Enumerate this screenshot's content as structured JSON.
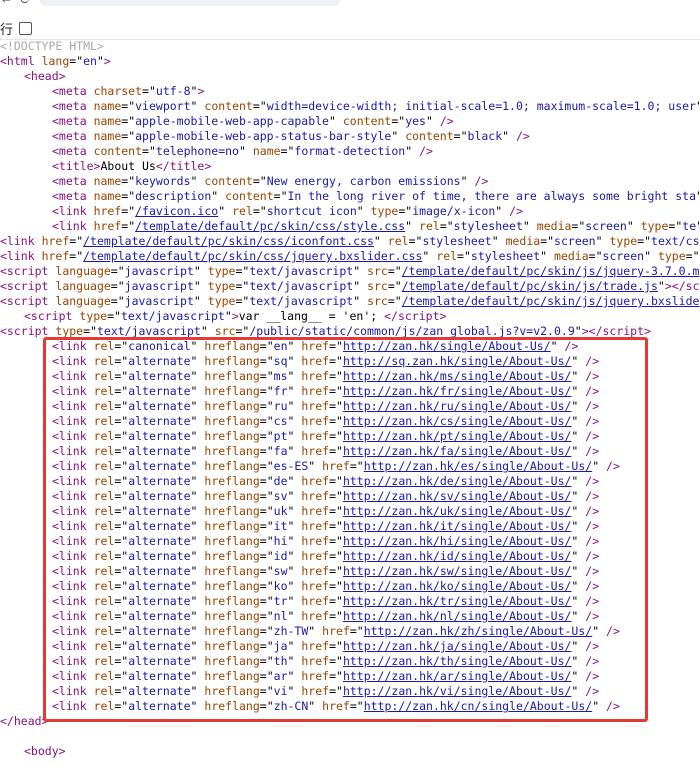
{
  "toolbar": {
    "wrap_label": "行"
  },
  "code_lines": [
    {
      "indent": 0,
      "raw": "<!DOCTYPE HTML>"
    },
    {
      "indent": 0,
      "tag": "html",
      "attrs": [
        [
          "lang",
          "en"
        ]
      ]
    },
    {
      "indent": 24,
      "tag": "head",
      "attrs": []
    },
    {
      "indent": 52,
      "tag": "meta",
      "attrs": [
        [
          "charset",
          "utf-8"
        ]
      ]
    },
    {
      "indent": 52,
      "tag": "meta",
      "attrs": [
        [
          "name",
          "viewport"
        ],
        [
          "content",
          "width=device-width; initial-scale=1.0; maximum-scale=1.0; user"
        ]
      ],
      "noclose": true
    },
    {
      "indent": 52,
      "tag": "meta",
      "attrs": [
        [
          "name",
          "apple-mobile-web-app-capable"
        ],
        [
          "content",
          "yes"
        ]
      ],
      "selfclose": true
    },
    {
      "indent": 52,
      "tag": "meta",
      "attrs": [
        [
          "name",
          "apple-mobile-web-app-status-bar-style"
        ],
        [
          "content",
          "black"
        ]
      ],
      "selfclose": true
    },
    {
      "indent": 52,
      "tag": "meta",
      "attrs": [
        [
          "content",
          "telephone=no"
        ],
        [
          "name",
          "format-detection"
        ]
      ],
      "selfclose": true
    },
    {
      "indent": 52,
      "tag": "title",
      "text": "About Us",
      "closetag": "title"
    },
    {
      "indent": 52,
      "tag": "meta",
      "attrs": [
        [
          "name",
          "keywords"
        ],
        [
          "content",
          "New energy, carbon emissions"
        ]
      ],
      "selfclose": true
    },
    {
      "indent": 52,
      "tag": "meta",
      "attrs": [
        [
          "name",
          "description"
        ],
        [
          "content",
          "In the long river of time, there are always some bright sta"
        ]
      ],
      "noclose": true
    },
    {
      "indent": 52,
      "tag": "link",
      "attrs": [
        [
          "href",
          "/favicon.ico",
          "link"
        ],
        [
          "rel",
          "shortcut icon"
        ],
        [
          "type",
          "image/x-icon"
        ]
      ],
      "selfclose": true
    },
    {
      "indent": 52,
      "tag": "link",
      "attrs": [
        [
          "href",
          "/template/default/pc/skin/css/style.css",
          "link"
        ],
        [
          "rel",
          "stylesheet"
        ],
        [
          "media",
          "screen"
        ],
        [
          "type",
          "te"
        ]
      ],
      "noclose": true
    },
    {
      "indent": 0,
      "tag": "link",
      "attrs": [
        [
          "href",
          "/template/default/pc/skin/css/iconfont.css",
          "link"
        ],
        [
          "rel",
          "stylesheet"
        ],
        [
          "media",
          "screen"
        ],
        [
          "type",
          "text/cs"
        ]
      ],
      "noclose": true
    },
    {
      "indent": 0,
      "tag": "link",
      "attrs": [
        [
          "href",
          "/template/default/pc/skin/css/jquery.bxslider.css",
          "link"
        ],
        [
          "rel",
          "stylesheet"
        ],
        [
          "media",
          "screen"
        ],
        [
          "type",
          ""
        ]
      ],
      "noclose": true
    },
    {
      "indent": 0,
      "tag": "script",
      "attrs": [
        [
          "language",
          "javascript"
        ],
        [
          "type",
          "text/javascript"
        ],
        [
          "src",
          "/template/default/pc/skin/js/jquery-3.7.0.m",
          "link"
        ]
      ],
      "noclose": true
    },
    {
      "indent": 0,
      "tag": "script",
      "attrs": [
        [
          "language",
          "javascript"
        ],
        [
          "type",
          "text/javascript"
        ],
        [
          "src",
          "/template/default/pc/skin/js/trade.js",
          "link"
        ]
      ],
      "text": "",
      "closetag": "scr"
    },
    {
      "indent": 0,
      "tag": "script",
      "attrs": [
        [
          "language",
          "javascript"
        ],
        [
          "type",
          "text/javascript"
        ],
        [
          "src",
          "/template/default/pc/skin/js/jquery.bxslide",
          "link"
        ]
      ],
      "noclose": true
    },
    {
      "indent": 24,
      "tag": "script",
      "attrs": [
        [
          "type",
          "text/javascript"
        ]
      ],
      "text": "var __lang__ = 'en'; ",
      "closetag": "script"
    },
    {
      "indent": 0,
      "tag": "script",
      "attrs": [
        [
          "type",
          "text/javascript"
        ],
        [
          "src",
          "/public/static/common/js/zan_global.js?v=v2.0.9"
        ]
      ],
      "text": "",
      "closetag": "script"
    },
    {
      "indent": 52,
      "tag": "link",
      "attrs": [
        [
          "rel",
          "canonical"
        ],
        [
          "hreflang",
          "en"
        ],
        [
          "href",
          "http://zan.hk/single/About-Us/",
          "link"
        ]
      ],
      "selfclose": true
    },
    {
      "indent": 52,
      "tag": "link",
      "attrs": [
        [
          "rel",
          "alternate"
        ],
        [
          "hreflang",
          "sq"
        ],
        [
          "href",
          "http://sq.zan.hk/single/About-Us/",
          "link"
        ]
      ],
      "selfclose": true
    },
    {
      "indent": 52,
      "tag": "link",
      "attrs": [
        [
          "rel",
          "alternate"
        ],
        [
          "hreflang",
          "ms"
        ],
        [
          "href",
          "http://zan.hk/ms/single/About-Us/",
          "link"
        ]
      ],
      "selfclose": true
    },
    {
      "indent": 52,
      "tag": "link",
      "attrs": [
        [
          "rel",
          "alternate"
        ],
        [
          "hreflang",
          "fr"
        ],
        [
          "href",
          "http://zan.hk/fr/single/About-Us/",
          "link"
        ]
      ],
      "selfclose": true
    },
    {
      "indent": 52,
      "tag": "link",
      "attrs": [
        [
          "rel",
          "alternate"
        ],
        [
          "hreflang",
          "ru"
        ],
        [
          "href",
          "http://zan.hk/ru/single/About-Us/",
          "link"
        ]
      ],
      "selfclose": true
    },
    {
      "indent": 52,
      "tag": "link",
      "attrs": [
        [
          "rel",
          "alternate"
        ],
        [
          "hreflang",
          "cs"
        ],
        [
          "href",
          "http://zan.hk/cs/single/About-Us/",
          "link"
        ]
      ],
      "selfclose": true
    },
    {
      "indent": 52,
      "tag": "link",
      "attrs": [
        [
          "rel",
          "alternate"
        ],
        [
          "hreflang",
          "pt"
        ],
        [
          "href",
          "http://zan.hk/pt/single/About-Us/",
          "link"
        ]
      ],
      "selfclose": true
    },
    {
      "indent": 52,
      "tag": "link",
      "attrs": [
        [
          "rel",
          "alternate"
        ],
        [
          "hreflang",
          "fa"
        ],
        [
          "href",
          "http://zan.hk/fa/single/About-Us/",
          "link"
        ]
      ],
      "selfclose": true
    },
    {
      "indent": 52,
      "tag": "link",
      "attrs": [
        [
          "rel",
          "alternate"
        ],
        [
          "hreflang",
          "es-ES"
        ],
        [
          "href",
          "http://zan.hk/es/single/About-Us/",
          "link"
        ]
      ],
      "selfclose": true
    },
    {
      "indent": 52,
      "tag": "link",
      "attrs": [
        [
          "rel",
          "alternate"
        ],
        [
          "hreflang",
          "de"
        ],
        [
          "href",
          "http://zan.hk/de/single/About-Us/",
          "link"
        ]
      ],
      "selfclose": true
    },
    {
      "indent": 52,
      "tag": "link",
      "attrs": [
        [
          "rel",
          "alternate"
        ],
        [
          "hreflang",
          "sv"
        ],
        [
          "href",
          "http://zan.hk/sv/single/About-Us/",
          "link"
        ]
      ],
      "selfclose": true
    },
    {
      "indent": 52,
      "tag": "link",
      "attrs": [
        [
          "rel",
          "alternate"
        ],
        [
          "hreflang",
          "uk"
        ],
        [
          "href",
          "http://zan.hk/uk/single/About-Us/",
          "link"
        ]
      ],
      "selfclose": true
    },
    {
      "indent": 52,
      "tag": "link",
      "attrs": [
        [
          "rel",
          "alternate"
        ],
        [
          "hreflang",
          "it"
        ],
        [
          "href",
          "http://zan.hk/it/single/About-Us/",
          "link"
        ]
      ],
      "selfclose": true
    },
    {
      "indent": 52,
      "tag": "link",
      "attrs": [
        [
          "rel",
          "alternate"
        ],
        [
          "hreflang",
          "hi"
        ],
        [
          "href",
          "http://zan.hk/hi/single/About-Us/",
          "link"
        ]
      ],
      "selfclose": true
    },
    {
      "indent": 52,
      "tag": "link",
      "attrs": [
        [
          "rel",
          "alternate"
        ],
        [
          "hreflang",
          "id"
        ],
        [
          "href",
          "http://zan.hk/id/single/About-Us/",
          "link"
        ]
      ],
      "selfclose": true
    },
    {
      "indent": 52,
      "tag": "link",
      "attrs": [
        [
          "rel",
          "alternate"
        ],
        [
          "hreflang",
          "sw"
        ],
        [
          "href",
          "http://zan.hk/sw/single/About-Us/",
          "link"
        ]
      ],
      "selfclose": true
    },
    {
      "indent": 52,
      "tag": "link",
      "attrs": [
        [
          "rel",
          "alternate"
        ],
        [
          "hreflang",
          "ko"
        ],
        [
          "href",
          "http://zan.hk/ko/single/About-Us/",
          "link"
        ]
      ],
      "selfclose": true
    },
    {
      "indent": 52,
      "tag": "link",
      "attrs": [
        [
          "rel",
          "alternate"
        ],
        [
          "hreflang",
          "tr"
        ],
        [
          "href",
          "http://zan.hk/tr/single/About-Us/",
          "link"
        ]
      ],
      "selfclose": true
    },
    {
      "indent": 52,
      "tag": "link",
      "attrs": [
        [
          "rel",
          "alternate"
        ],
        [
          "hreflang",
          "nl"
        ],
        [
          "href",
          "http://zan.hk/nl/single/About-Us/",
          "link"
        ]
      ],
      "selfclose": true
    },
    {
      "indent": 52,
      "tag": "link",
      "attrs": [
        [
          "rel",
          "alternate"
        ],
        [
          "hreflang",
          "zh-TW"
        ],
        [
          "href",
          "http://zan.hk/zh/single/About-Us/",
          "link"
        ]
      ],
      "selfclose": true
    },
    {
      "indent": 52,
      "tag": "link",
      "attrs": [
        [
          "rel",
          "alternate"
        ],
        [
          "hreflang",
          "ja"
        ],
        [
          "href",
          "http://zan.hk/ja/single/About-Us/",
          "link"
        ]
      ],
      "selfclose": true
    },
    {
      "indent": 52,
      "tag": "link",
      "attrs": [
        [
          "rel",
          "alternate"
        ],
        [
          "hreflang",
          "th"
        ],
        [
          "href",
          "http://zan.hk/th/single/About-Us/",
          "link"
        ]
      ],
      "selfclose": true
    },
    {
      "indent": 52,
      "tag": "link",
      "attrs": [
        [
          "rel",
          "alternate"
        ],
        [
          "hreflang",
          "ar"
        ],
        [
          "href",
          "http://zan.hk/ar/single/About-Us/",
          "link"
        ]
      ],
      "selfclose": true
    },
    {
      "indent": 52,
      "tag": "link",
      "attrs": [
        [
          "rel",
          "alternate"
        ],
        [
          "hreflang",
          "vi"
        ],
        [
          "href",
          "http://zan.hk/vi/single/About-Us/",
          "link"
        ]
      ],
      "selfclose": true
    },
    {
      "indent": 52,
      "tag": "link",
      "attrs": [
        [
          "rel",
          "alternate"
        ],
        [
          "hreflang",
          "zh-CN"
        ],
        [
          "href",
          "http://zan.hk/cn/single/About-Us/",
          "link"
        ]
      ],
      "selfclose": true
    },
    {
      "indent": 0,
      "endtag": "head"
    },
    {
      "indent": 24,
      "tag": "body",
      "attrs": [],
      "gap": true
    }
  ],
  "colors": {
    "tag": "#881280",
    "attr": "#994500",
    "value": "#1a1aa6",
    "highlight_border": "#e53935"
  }
}
